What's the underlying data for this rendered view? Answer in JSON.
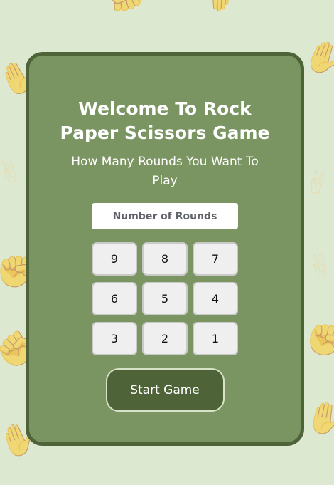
{
  "colors": {
    "background": "#dce8cf",
    "card": "#7a9462",
    "card_border": "#4f6338",
    "button": "#efefef",
    "start_button": "#4f6338"
  },
  "background_icons": [
    "hand-icon"
  ],
  "card": {
    "title": "Welcome To Rock Paper Scissors Game",
    "subtitle": "How Many Rounds You Want To Play",
    "input": {
      "placeholder": "Number of Rounds",
      "value": ""
    },
    "round_buttons": [
      "9",
      "8",
      "7",
      "6",
      "5",
      "4",
      "3",
      "2",
      "1"
    ],
    "start_label": "Start Game"
  }
}
